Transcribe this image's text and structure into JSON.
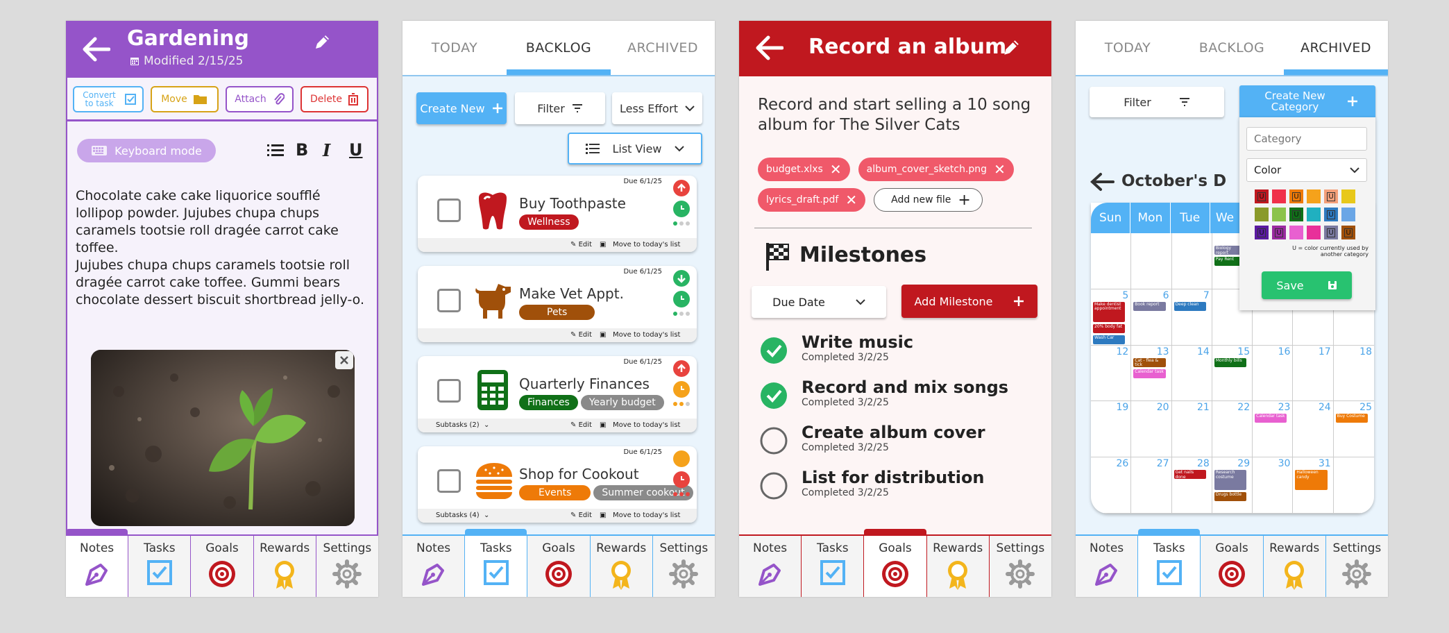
{
  "nav": [
    "Notes",
    "Tasks",
    "Goals",
    "Rewards",
    "Settings"
  ],
  "tabs": [
    "TODAY",
    "BACKLOG",
    "ARCHIVED"
  ],
  "p1": {
    "title": "Gardening",
    "modified": "Modified 2/15/25",
    "toolbar": [
      "Convert to task",
      "Move",
      "Attach",
      "Delete"
    ],
    "keyboard_mode": "Keyboard mode",
    "format": [
      "B",
      "I",
      "U"
    ],
    "para1": "Chocolate cake cake liquorice soufflé lollipop powder. Jujubes chupa chups caramels tootsie roll dragée carrot cake toffee.",
    "para2": "Jujubes chupa chups caramels tootsie roll dragée carrot cake toffee. Gummi bears chocolate dessert biscuit shortbread jelly-o.",
    "colors": {
      "accent": "#9554c9"
    }
  },
  "p2": {
    "create_new": "Create New",
    "filter": "Filter",
    "effort": "Less Effort",
    "view": "List View",
    "edit": "Edit",
    "move": "Move to today's list",
    "tasks": [
      {
        "title": "Buy Toothpaste",
        "due": "Due 6/1/25",
        "tags": [
          {
            "t": "Wellness",
            "c": "#c0181f"
          }
        ],
        "icon": "tooth-icon",
        "priority": "up",
        "sub": ""
      },
      {
        "title": "Make Vet Appt.",
        "due": "Due 6/1/25",
        "tags": [
          {
            "t": "Pets",
            "c": "#a0500a"
          }
        ],
        "icon": "dog-icon",
        "priority": "down",
        "sub": ""
      },
      {
        "title": "Quarterly Finances",
        "due": "Due 6/1/25",
        "tags": [
          {
            "t": "Finances",
            "c": "#107018"
          },
          {
            "t": "Yearly budget",
            "c": "#8a8a8a"
          }
        ],
        "icon": "calculator-icon",
        "priority": "up",
        "sub": "Subtasks (2)"
      },
      {
        "title": "Shop for Cookout",
        "due": "Due 6/1/25",
        "tags": [
          {
            "t": "Events",
            "c": "#ee7a08"
          },
          {
            "t": "Summer cookout",
            "c": "#8a8a8a"
          }
        ],
        "icon": "burger-icon",
        "priority": "none",
        "sub": "Subtasks (4)"
      }
    ]
  },
  "p3": {
    "title": "Record an album",
    "desc": "Record and start selling a 10 song album for The Silver Cats",
    "files": [
      "budget.xlxs",
      "album_cover_sketch.png",
      "lyrics_draft.pdf"
    ],
    "add_file": "Add new file",
    "milestones_title": "Milestones",
    "sort": "Due Date",
    "add_milestone": "Add Milestone",
    "milestones": [
      {
        "t": "Write music",
        "s": "Completed 3/2/25",
        "done": true
      },
      {
        "t": "Record and mix songs",
        "s": "Completed 3/2/25",
        "done": true
      },
      {
        "t": "Create album cover",
        "s": "Completed 3/2/25",
        "done": false
      },
      {
        "t": "List for distribution",
        "s": "Completed 3/2/25",
        "done": false
      }
    ],
    "colors": {
      "accent": "#c0181f"
    }
  },
  "p4": {
    "filter": "Filter",
    "create_category": "Create New Category",
    "category_placeholder": "Category",
    "color_label": "Color",
    "legend": "U = color currently used by another category",
    "save": "Save",
    "month_title": "October's D",
    "days": [
      "Sun",
      "Mon",
      "Tue",
      "We"
    ],
    "palette": [
      "#c0181f",
      "#f0314a",
      "#ee7a08",
      "#f5a21b",
      "#f4a07a",
      "#e8c81a",
      "#8a9a2a",
      "#8bc34a",
      "#107018",
      "#20b0c0",
      "#2d7ac0",
      "#6aa6e6",
      "#5a1aa0",
      "#9a2aa0",
      "#e860d0",
      "#e8309a",
      "#7a7aa0",
      "#a0500a"
    ],
    "used": [
      0,
      2,
      4,
      8,
      10,
      12,
      13,
      16,
      17
    ],
    "u": "U",
    "dates": [
      [
        "",
        "",
        "",
        "",
        "",
        "",
        ""
      ],
      [
        "5",
        "6",
        "7",
        "",
        "",
        "",
        ""
      ],
      [
        "12",
        "13",
        "14",
        "15",
        "16",
        "17",
        "18"
      ],
      [
        "19",
        "20",
        "21",
        "22",
        "23",
        "24",
        "25"
      ],
      [
        "26",
        "27",
        "28",
        "29",
        "30",
        "31",
        ""
      ]
    ],
    "events": [
      {
        "w": 0,
        "d": 3,
        "i": 0,
        "t": "Biology report",
        "c": "#7a7aa0"
      },
      {
        "w": 0,
        "d": 3,
        "i": 1,
        "t": "Pay Rent",
        "c": "#107018"
      },
      {
        "w": 1,
        "d": 0,
        "i": 0,
        "t": "Make dentist appointment",
        "c": "#c0181f",
        "h": 2
      },
      {
        "w": 1,
        "d": 0,
        "i": 2,
        "t": "20% body fat",
        "c": "#c0181f"
      },
      {
        "w": 1,
        "d": 0,
        "i": 3,
        "t": "Wash Car",
        "c": "#2d7ac0"
      },
      {
        "w": 1,
        "d": 1,
        "i": 0,
        "t": "Book report",
        "c": "#7a7aa0"
      },
      {
        "w": 1,
        "d": 2,
        "i": 0,
        "t": "Deep clean",
        "c": "#2d7ac0"
      },
      {
        "w": 2,
        "d": 1,
        "i": 0,
        "t": "Cat - flea & tick",
        "c": "#a0500a"
      },
      {
        "w": 2,
        "d": 1,
        "i": 1,
        "t": "Calendar task",
        "c": "#e860d0"
      },
      {
        "w": 2,
        "d": 3,
        "i": 0,
        "t": "Monthly bills",
        "c": "#107018"
      },
      {
        "w": 3,
        "d": 4,
        "i": 0,
        "t": "Calendar task",
        "c": "#e860d0"
      },
      {
        "w": 3,
        "d": 6,
        "i": 0,
        "t": "Buy Costume",
        "c": "#ee7a08"
      },
      {
        "w": 4,
        "d": 2,
        "i": 0,
        "t": "Get nails done",
        "c": "#c0181f"
      },
      {
        "w": 4,
        "d": 3,
        "i": 0,
        "t": "Research costume",
        "c": "#7a7aa0",
        "h": 2
      },
      {
        "w": 4,
        "d": 3,
        "i": 2,
        "t": "Drugs bottle",
        "c": "#a0500a"
      },
      {
        "w": 4,
        "d": 5,
        "i": 0,
        "t": "Halloween candy",
        "c": "#ee7a08",
        "h": 2
      }
    ]
  }
}
